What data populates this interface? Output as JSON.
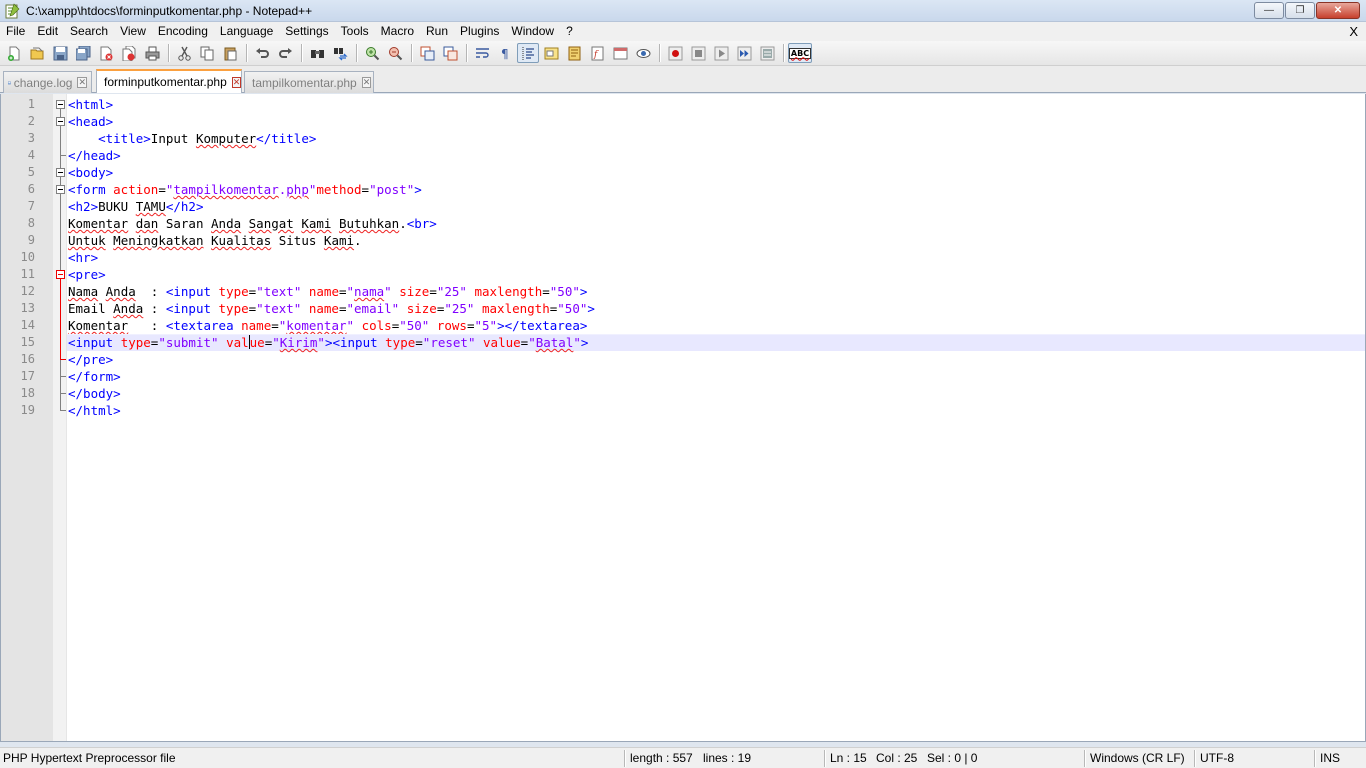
{
  "window": {
    "title": "C:\\xampp\\htdocs\\forminputkomentar.php - Notepad++",
    "minimize": "—",
    "maximize": "❐",
    "close": "✕"
  },
  "menu": {
    "items": [
      "File",
      "Edit",
      "Search",
      "View",
      "Encoding",
      "Language",
      "Settings",
      "Tools",
      "Macro",
      "Run",
      "Plugins",
      "Window",
      "?"
    ],
    "close": "X"
  },
  "toolbar": {
    "buttons": [
      "new-file-icon",
      "open-file-icon",
      "save-icon",
      "save-all-icon",
      "close-icon",
      "close-all-icon",
      "print-icon",
      "cut-icon",
      "copy-icon",
      "paste-icon",
      "undo-icon",
      "redo-icon",
      "find-icon",
      "replace-icon",
      "zoom-in-icon",
      "zoom-out-icon",
      "sync-vertical-icon",
      "sync-horizontal-icon",
      "word-wrap-icon",
      "show-all-chars-icon",
      "indent-guide-icon",
      "user-language-icon",
      "doc-map-icon",
      "function-list-icon",
      "folder-workspace-icon",
      "monitoring-icon",
      "record-macro-icon",
      "stop-macro-icon",
      "play-macro-icon",
      "run-macro-multiple-icon",
      "save-macro-icon",
      "spell-check-icon"
    ],
    "spellcheck_label": "ABC"
  },
  "tabs": [
    {
      "label": "change.log",
      "active": false
    },
    {
      "label": "forminputkomentar.php",
      "active": true
    },
    {
      "label": "tampilkomentar.php",
      "active": false
    }
  ],
  "editor": {
    "current_line": 15,
    "lines": [
      {
        "n": "1",
        "tokens": [
          [
            "tag",
            "<html>"
          ]
        ]
      },
      {
        "n": "2",
        "tokens": [
          [
            "tag",
            "<head>"
          ]
        ]
      },
      {
        "n": "3",
        "tokens": [
          [
            "txt",
            "    "
          ],
          [
            "tag",
            "<title>"
          ],
          [
            "txt",
            "Input "
          ],
          [
            "spell",
            "Komputer"
          ],
          [
            "tag",
            "</title>"
          ]
        ]
      },
      {
        "n": "4",
        "tokens": [
          [
            "tag",
            "</head>"
          ]
        ]
      },
      {
        "n": "5",
        "tokens": [
          [
            "tag",
            "<body>"
          ]
        ]
      },
      {
        "n": "6",
        "tokens": [
          [
            "tag",
            "<form "
          ],
          [
            "attr",
            "action"
          ],
          [
            "txt",
            "="
          ],
          [
            "val",
            "\""
          ],
          [
            "valspell",
            "tampilkomentar"
          ],
          [
            "val",
            "."
          ],
          [
            "valspell",
            "php"
          ],
          [
            "val",
            "\""
          ],
          [
            "attr",
            "method"
          ],
          [
            "txt",
            "="
          ],
          [
            "val",
            "\"post\""
          ],
          [
            "tag",
            ">"
          ]
        ]
      },
      {
        "n": "7",
        "tokens": [
          [
            "tag",
            "<h2>"
          ],
          [
            "txt",
            "BUKU "
          ],
          [
            "spell",
            "TAMU"
          ],
          [
            "tag",
            "</h2>"
          ]
        ]
      },
      {
        "n": "8",
        "tokens": [
          [
            "spell",
            "Komentar"
          ],
          [
            "txt",
            " "
          ],
          [
            "spell",
            "dan"
          ],
          [
            "txt",
            " Saran "
          ],
          [
            "spell",
            "Anda"
          ],
          [
            "txt",
            " "
          ],
          [
            "spell",
            "Sangat"
          ],
          [
            "txt",
            " "
          ],
          [
            "spell",
            "Kami"
          ],
          [
            "txt",
            " "
          ],
          [
            "spell",
            "Butuhkan"
          ],
          [
            "txt",
            "."
          ],
          [
            "tag",
            "<br>"
          ]
        ]
      },
      {
        "n": "9",
        "tokens": [
          [
            "spell",
            "Untuk"
          ],
          [
            "txt",
            " "
          ],
          [
            "spell",
            "Meningkatkan"
          ],
          [
            "txt",
            " "
          ],
          [
            "spell",
            "Kualitas"
          ],
          [
            "txt",
            " Situs "
          ],
          [
            "spell",
            "Kami"
          ],
          [
            "txt",
            "."
          ]
        ]
      },
      {
        "n": "10",
        "tokens": [
          [
            "tag",
            "<hr>"
          ]
        ]
      },
      {
        "n": "11",
        "tokens": [
          [
            "tag",
            "<pre>"
          ]
        ]
      },
      {
        "n": "12",
        "tokens": [
          [
            "spell",
            "Nama"
          ],
          [
            "txt",
            " "
          ],
          [
            "spell",
            "Anda"
          ],
          [
            "txt",
            "  : "
          ],
          [
            "tag",
            "<input "
          ],
          [
            "attr",
            "type"
          ],
          [
            "txt",
            "="
          ],
          [
            "val",
            "\"text\" "
          ],
          [
            "attr",
            "name"
          ],
          [
            "txt",
            "="
          ],
          [
            "val",
            "\""
          ],
          [
            "valspell",
            "nama"
          ],
          [
            "val",
            "\" "
          ],
          [
            "attr",
            "size"
          ],
          [
            "txt",
            "="
          ],
          [
            "val",
            "\"25\" "
          ],
          [
            "attr",
            "maxlength"
          ],
          [
            "txt",
            "="
          ],
          [
            "val",
            "\"50\""
          ],
          [
            "tag",
            ">"
          ]
        ]
      },
      {
        "n": "13",
        "tokens": [
          [
            "txt",
            "Email "
          ],
          [
            "spell",
            "Anda"
          ],
          [
            "txt",
            " : "
          ],
          [
            "tag",
            "<input "
          ],
          [
            "attr",
            "type"
          ],
          [
            "txt",
            "="
          ],
          [
            "val",
            "\"text\" "
          ],
          [
            "attr",
            "name"
          ],
          [
            "txt",
            "="
          ],
          [
            "val",
            "\"email\" "
          ],
          [
            "attr",
            "size"
          ],
          [
            "txt",
            "="
          ],
          [
            "val",
            "\"25\" "
          ],
          [
            "attr",
            "maxlength"
          ],
          [
            "txt",
            "="
          ],
          [
            "val",
            "\"50\""
          ],
          [
            "tag",
            ">"
          ]
        ]
      },
      {
        "n": "14",
        "tokens": [
          [
            "spell",
            "Komentar"
          ],
          [
            "txt",
            "   : "
          ],
          [
            "tag",
            "<textarea "
          ],
          [
            "attr",
            "name"
          ],
          [
            "txt",
            "="
          ],
          [
            "val",
            "\""
          ],
          [
            "valspell",
            "komentar"
          ],
          [
            "val",
            "\" "
          ],
          [
            "attr",
            "cols"
          ],
          [
            "txt",
            "="
          ],
          [
            "val",
            "\"50\" "
          ],
          [
            "attr",
            "rows"
          ],
          [
            "txt",
            "="
          ],
          [
            "val",
            "\"5\""
          ],
          [
            "tag",
            "></textarea>"
          ]
        ]
      },
      {
        "n": "15",
        "tokens": [
          [
            "tag",
            "<input "
          ],
          [
            "attr",
            "type"
          ],
          [
            "txt",
            "="
          ],
          [
            "val",
            "\"submit\" "
          ],
          [
            "attr",
            "val"
          ],
          [
            "caret",
            ""
          ],
          [
            "attr",
            "ue"
          ],
          [
            "txt",
            "="
          ],
          [
            "val",
            "\""
          ],
          [
            "valspell",
            "Kirim"
          ],
          [
            "val",
            "\""
          ],
          [
            "tag",
            "><input "
          ],
          [
            "attr",
            "type"
          ],
          [
            "txt",
            "="
          ],
          [
            "val",
            "\"reset\" "
          ],
          [
            "attr",
            "value"
          ],
          [
            "txt",
            "="
          ],
          [
            "val",
            "\""
          ],
          [
            "valspell",
            "Batal"
          ],
          [
            "val",
            "\""
          ],
          [
            "tag",
            ">"
          ]
        ]
      },
      {
        "n": "16",
        "tokens": [
          [
            "tag",
            "</pre>"
          ]
        ]
      },
      {
        "n": "17",
        "tokens": [
          [
            "tag",
            "</form>"
          ]
        ]
      },
      {
        "n": "18",
        "tokens": [
          [
            "tag",
            "</body>"
          ]
        ]
      },
      {
        "n": "19",
        "tokens": [
          [
            "tag",
            "</html>"
          ]
        ]
      }
    ]
  },
  "status": {
    "file_type": "PHP Hypertext Preprocessor file",
    "length": "length : 557",
    "lines": "lines : 19",
    "ln": "Ln : 15",
    "col": "Col : 25",
    "sel": "Sel : 0 | 0",
    "eol": "Windows (CR LF)",
    "encoding": "UTF-8",
    "mode": "INS"
  }
}
